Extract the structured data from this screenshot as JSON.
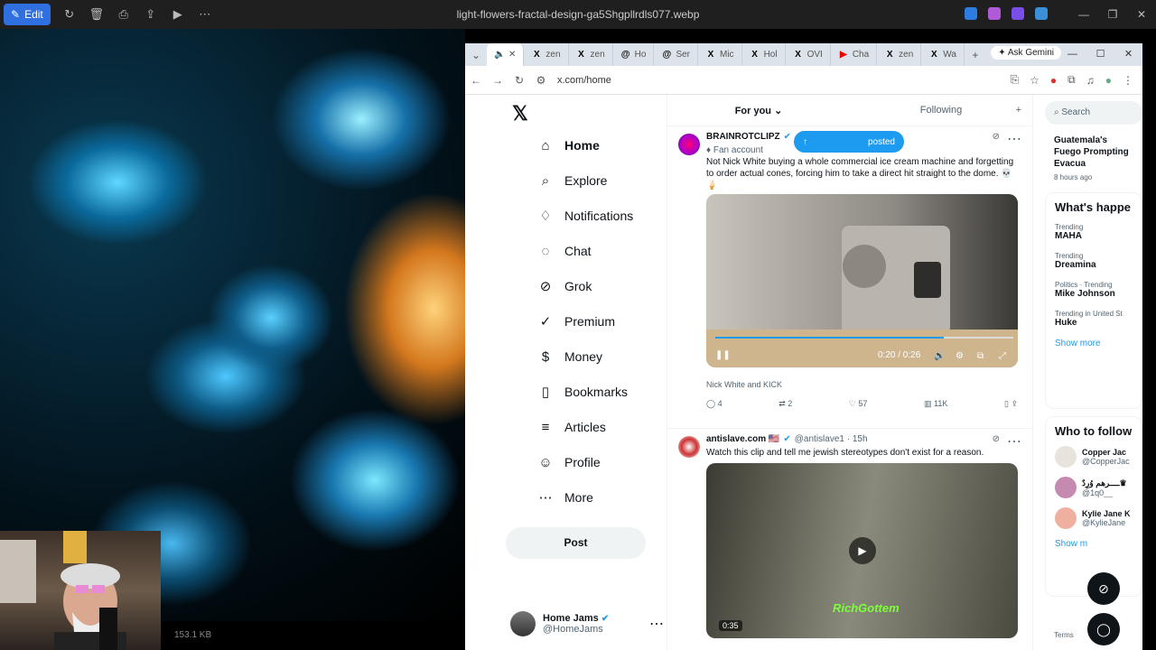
{
  "viewer": {
    "edit_label": "Edit",
    "file_title": "light-flowers-fractal-design-ga5Shgpllrdls077.webp",
    "file_size": "153.1 KB"
  },
  "browser": {
    "tabs": [
      {
        "icon": "speaker-icon",
        "label": ""
      },
      {
        "icon": "x-logo-icon",
        "label": "zen"
      },
      {
        "icon": "x-logo-icon",
        "label": "zen"
      },
      {
        "icon": "threads-icon",
        "label": "Ho"
      },
      {
        "icon": "threads-icon",
        "label": "Ser"
      },
      {
        "icon": "x-logo-icon",
        "label": "Mic"
      },
      {
        "icon": "x-logo-icon",
        "label": "Hol"
      },
      {
        "icon": "x-logo-icon",
        "label": "OVI"
      },
      {
        "icon": "youtube-icon",
        "label": "Cha"
      },
      {
        "icon": "x-logo-icon",
        "label": "zen"
      },
      {
        "icon": "x-logo-icon",
        "label": "Wa"
      }
    ],
    "ask_gemini": "Ask Gemini",
    "url": "x.com/home"
  },
  "x": {
    "nav": [
      {
        "label": "Home",
        "icon": "home-icon",
        "glyph": "⌂"
      },
      {
        "label": "Explore",
        "icon": "search-icon",
        "glyph": "⌕"
      },
      {
        "label": "Notifications",
        "icon": "bell-icon",
        "glyph": "♢"
      },
      {
        "label": "Chat",
        "icon": "chat-icon",
        "glyph": "◌"
      },
      {
        "label": "Grok",
        "icon": "grok-icon",
        "glyph": "⊘"
      },
      {
        "label": "Premium",
        "icon": "premium-icon",
        "glyph": "✓"
      },
      {
        "label": "Money",
        "icon": "money-icon",
        "glyph": "$"
      },
      {
        "label": "Bookmarks",
        "icon": "bookmark-icon",
        "glyph": "▯"
      },
      {
        "label": "Articles",
        "icon": "articles-icon",
        "glyph": "≡"
      },
      {
        "label": "Profile",
        "icon": "profile-icon",
        "glyph": "☺"
      },
      {
        "label": "More",
        "icon": "more-icon",
        "glyph": "⋯"
      }
    ],
    "post_label": "Post",
    "account": {
      "name": "Home Jams",
      "handle": "@HomeJams"
    },
    "feed_tabs": {
      "for_you": "For you",
      "following": "Following"
    },
    "tweet1": {
      "name": "BRAINROTCLIPZ",
      "badge": "Fan account",
      "text": "Not Nick White buying a whole commercial ice cream machine and forgetting to order actual cones, forcing him to take a direct hit straight to the dome. 💀🍦",
      "posted": "posted",
      "video_time": "0:20 / 0:26",
      "caption": "Nick White and KICK",
      "replies": "4",
      "reposts": "2",
      "likes": "57",
      "views": "11K"
    },
    "tweet2": {
      "name": "antislave.com 🇺🇸",
      "handle": "@antislave1 · 15h",
      "text": "Watch this clip and tell me jewish stereotypes don't exist for a reason.",
      "duration": "0:35",
      "watermark": "RichGottem"
    },
    "right": {
      "search_placeholder": "Search",
      "news_title": "Guatemala's Fuego Prompting Evacua",
      "news_time": "8 hours ago",
      "happening_title": "What's happe",
      "trends": [
        {
          "cat": "Trending",
          "name": "MAHA"
        },
        {
          "cat": "Trending",
          "name": "Dreamina"
        },
        {
          "cat": "Politics · Trending",
          "name": "Mike Johnson"
        },
        {
          "cat": "Trending in United St",
          "name": "Huke"
        }
      ],
      "show_more": "Show more",
      "who_title": "Who to follow",
      "follows": [
        {
          "name": "Copper Jac",
          "handle": "@CopperJac"
        },
        {
          "name": "ــــرهم وُرِدٌ♛",
          "handle": "@1q0__"
        },
        {
          "name": "Kylie Jane K",
          "handle": "@KylieJane"
        }
      ],
      "show_more_2": "Show m",
      "terms": "Terms"
    }
  }
}
